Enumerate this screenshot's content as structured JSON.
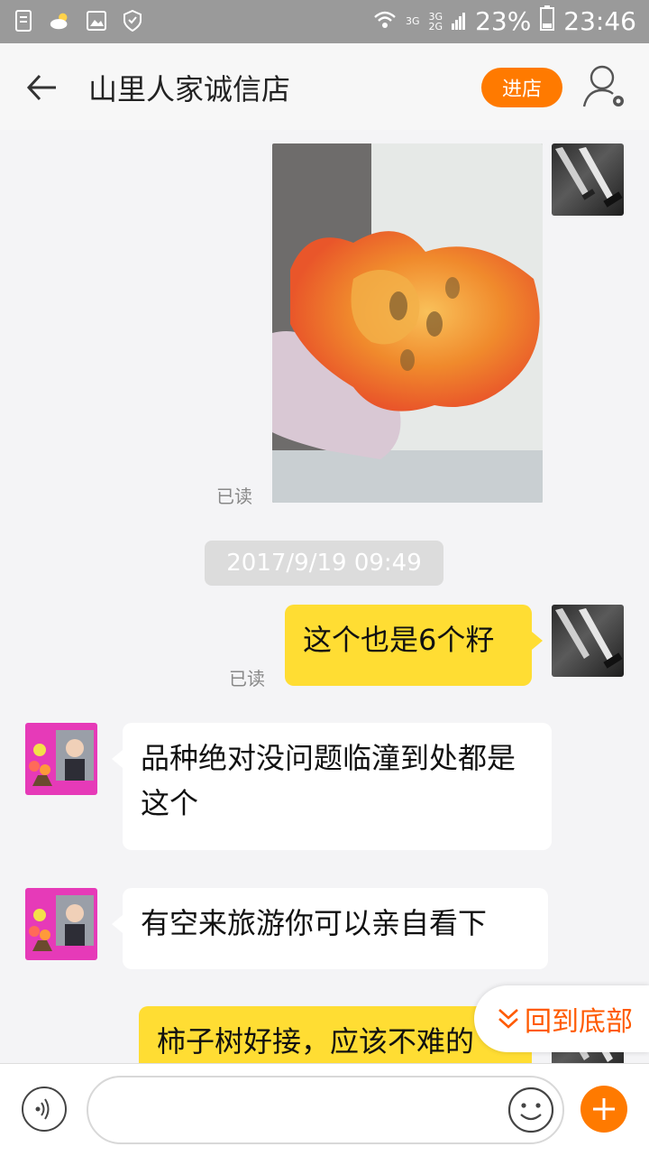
{
  "status_bar": {
    "network_top": "3G",
    "network_left": "3G",
    "network_right": "2G",
    "battery": "23%",
    "time": "23:46"
  },
  "header": {
    "title": "山里人家诚信店",
    "shop_button": "进店"
  },
  "messages": {
    "photo_read": "已读",
    "timestamp": "2017/9/19 09:49",
    "msg1": {
      "text": "这个也是6个籽",
      "read": "已读"
    },
    "msg2": {
      "text": "品种绝对没问题临潼到处都是这个"
    },
    "msg3": {
      "text": "有空来旅游你可以亲自看下"
    },
    "msg4": {
      "text": "柿子树好接，应该不难的"
    }
  },
  "back_to_bottom": "回到底部",
  "input": {
    "value": ""
  },
  "colors": {
    "accent": "#ff7a00",
    "my_bubble": "#ffdd33",
    "back_to_bottom": "#ff5a00"
  },
  "icons": [
    "back-arrow-icon",
    "user-settings-icon",
    "voice-icon",
    "emoji-icon",
    "plus-icon",
    "chevron-down-icon"
  ]
}
